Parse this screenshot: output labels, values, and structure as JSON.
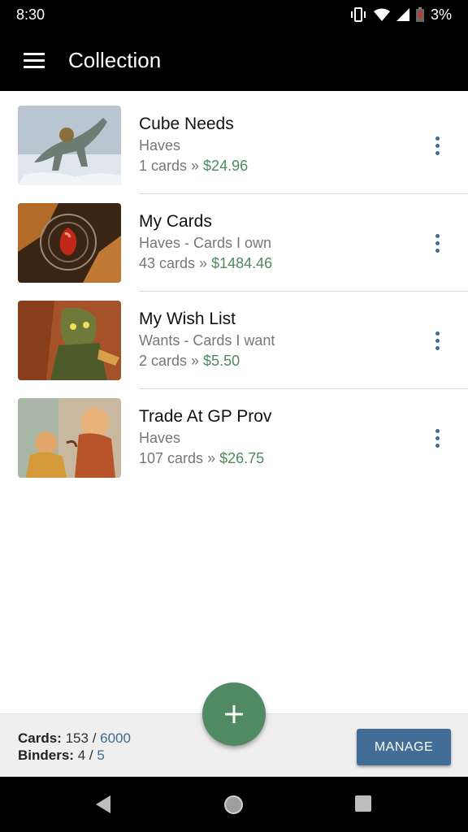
{
  "status_bar": {
    "time": "8:30",
    "battery": "3%"
  },
  "app_bar": {
    "title": "Collection",
    "menu_icon": "hamburger-menu-icon"
  },
  "binders": [
    {
      "name": "Cube Needs",
      "type": "Haves",
      "count": "1 cards",
      "sep": " » ",
      "price": "$24.96",
      "thumb": "dinosaur-art"
    },
    {
      "name": "My Cards",
      "type": "Haves - Cards I own",
      "count": "43 cards",
      "sep": " » ",
      "price": "$1484.46",
      "thumb": "red-gem-art"
    },
    {
      "name": "My Wish List",
      "type": "Wants - Cards I want",
      "count": "2 cards",
      "sep": " » ",
      "price": "$5.50",
      "thumb": "goblin-art"
    },
    {
      "name": "Trade At GP Prov",
      "type": "Haves",
      "count": "107 cards",
      "sep": " » ",
      "price": "$26.75",
      "thumb": "cheering-crowd-art"
    }
  ],
  "footer": {
    "cards_label": "Cards:",
    "cards_value": "153",
    "cards_sep": " / ",
    "cards_max": "6000",
    "binders_label": "Binders:",
    "binders_value": "4",
    "binders_sep": " / ",
    "binders_max": "5",
    "manage_label": "MANAGE"
  },
  "fab": {
    "icon": "plus-icon"
  },
  "colors": {
    "price": "#4e8a5e",
    "accent": "#426d96",
    "fab": "#508a63"
  },
  "nav": {
    "back_icon": "back-triangle-icon",
    "home_icon": "home-circle-icon",
    "recents_icon": "recents-square-icon"
  }
}
